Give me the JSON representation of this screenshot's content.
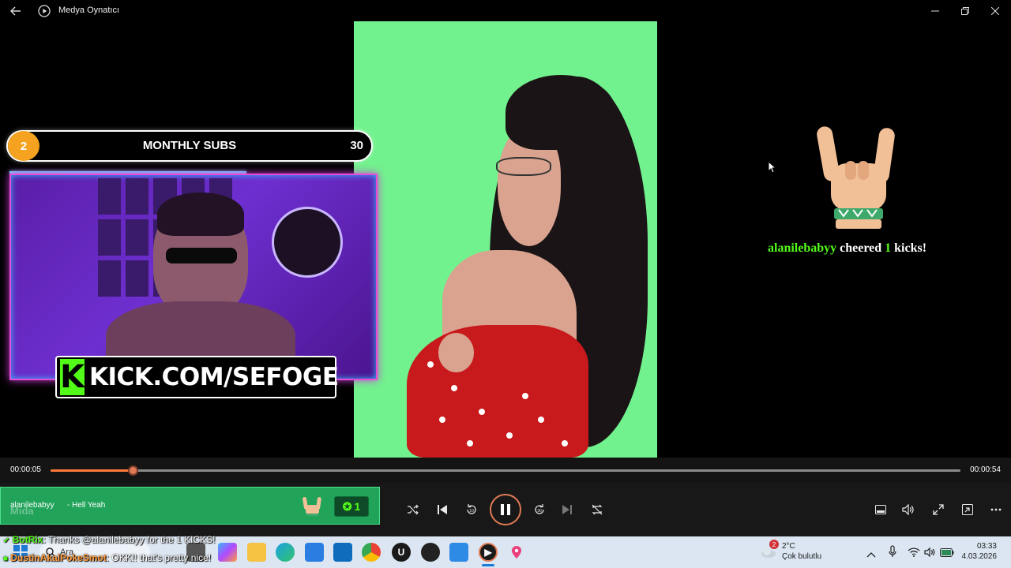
{
  "window": {
    "title": "Medya Oynatıcı"
  },
  "overlay": {
    "subs_badge": "2",
    "subs_label": "MONTHLY SUBS",
    "subs_count": "30",
    "kick_logo": "K",
    "kick_url": "KICK.COM/SEFOGE",
    "alert": {
      "user": "alanilebabyy",
      "verb": "cheered",
      "amount": "1",
      "unit": "kicks!"
    }
  },
  "player": {
    "elapsed": "00:00:05",
    "total": "00:00:54",
    "progress_fraction": 0.09
  },
  "chat_widget": {
    "user": "alanilebabyy",
    "message": "- Hell Yeah",
    "ghost_text": "Mida",
    "counter": "1"
  },
  "chat_lines": [
    {
      "user": "BotRix",
      "message": ": Thanks @alanilebabyy for the 1 KICKS!",
      "color": "#53fc18"
    },
    {
      "user": "DustinAkalPokeSmot",
      "message": ": OKK!! that's pretty nice!",
      "color": "#ff9b3d"
    }
  ],
  "taskbar": {
    "search_label": "Ara",
    "weather_badge": "2",
    "weather_temp": "2°C",
    "weather_desc": "Çok bulutlu",
    "time": "03:33",
    "date": "4.03.2026"
  },
  "colors": {
    "accent": "#e07a54",
    "kick_green": "#53fc18",
    "green_screen": "#72f28e"
  }
}
